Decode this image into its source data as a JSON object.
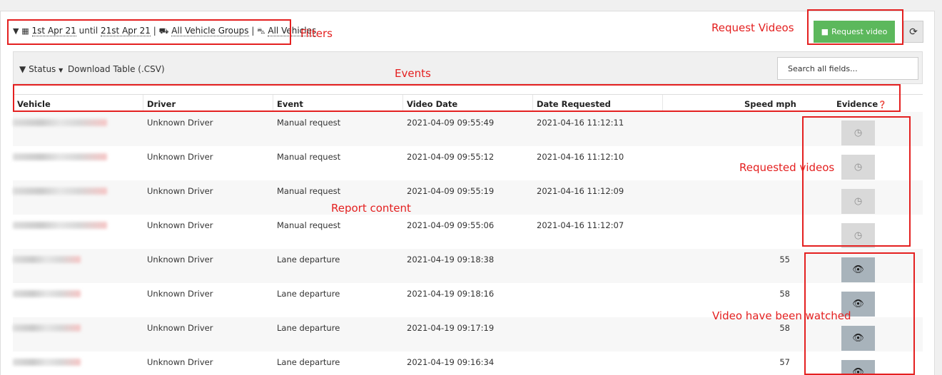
{
  "filters": {
    "date_from": "1st Apr 21",
    "until": "until",
    "date_to": "21st Apr 21",
    "sep": "|",
    "vehicle_groups": "All Vehicle Groups",
    "vehicles": "All Vehicles"
  },
  "buttons": {
    "request_video": "Request video"
  },
  "toolbar": {
    "status": "Status",
    "download": "Download Table (.CSV)",
    "search_placeholder": "Search all fields..."
  },
  "table": {
    "headers": {
      "vehicle": "Vehicle",
      "driver": "Driver",
      "event": "Event",
      "video_date": "Video Date",
      "date_requested": "Date Requested",
      "speed": "Speed mph",
      "evidence": "Evidence"
    },
    "rows": [
      {
        "driver": "Unknown Driver",
        "event": "Manual request",
        "video_date": "2021-04-09 09:55:49",
        "date_requested": "2021-04-16 11:12:11",
        "speed": "",
        "status": "pending"
      },
      {
        "driver": "Unknown Driver",
        "event": "Manual request",
        "video_date": "2021-04-09 09:55:12",
        "date_requested": "2021-04-16 11:12:10",
        "speed": "",
        "status": "pending"
      },
      {
        "driver": "Unknown Driver",
        "event": "Manual request",
        "video_date": "2021-04-09 09:55:19",
        "date_requested": "2021-04-16 11:12:09",
        "speed": "",
        "status": "pending"
      },
      {
        "driver": "Unknown Driver",
        "event": "Manual request",
        "video_date": "2021-04-09 09:55:06",
        "date_requested": "2021-04-16 11:12:07",
        "speed": "",
        "status": "pending"
      },
      {
        "driver": "Unknown Driver",
        "event": "Lane departure",
        "video_date": "2021-04-19 09:18:38",
        "date_requested": "",
        "speed": "55",
        "status": "watched"
      },
      {
        "driver": "Unknown Driver",
        "event": "Lane departure",
        "video_date": "2021-04-19 09:18:16",
        "date_requested": "",
        "speed": "58",
        "status": "watched"
      },
      {
        "driver": "Unknown Driver",
        "event": "Lane departure",
        "video_date": "2021-04-19 09:17:19",
        "date_requested": "",
        "speed": "58",
        "status": "watched"
      },
      {
        "driver": "Unknown Driver",
        "event": "Lane departure",
        "video_date": "2021-04-19 09:16:34",
        "date_requested": "",
        "speed": "57",
        "status": "watched"
      }
    ]
  },
  "annotations": {
    "filters": "Filters",
    "request_videos": "Request Videos",
    "events": "Events",
    "report_content": "Report content",
    "requested_videos": "Requested videos",
    "watched": "Video have been watched"
  },
  "colors": {
    "annotation": "#e42020",
    "request_button": "#5cb85c"
  },
  "icons": {
    "filter": "filter-icon",
    "calendar": "calendar-icon",
    "truck": "truck-icon",
    "car": "car-icon",
    "video": "video-camera-icon",
    "refresh": "refresh-icon",
    "help": "question-circle-icon",
    "clock": "clock-icon",
    "eye": "eye-icon"
  }
}
